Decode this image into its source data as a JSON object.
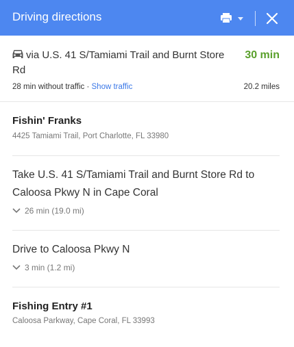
{
  "header": {
    "title": "Driving directions",
    "accent_color": "#4d87f0",
    "print_icon": "printer-icon",
    "close_icon": "close-icon"
  },
  "route": {
    "icon": "car-icon",
    "via": "via U.S. 41 S/Tamiami Trail and Burnt Store Rd",
    "duration": "30 min",
    "duration_color": "#5aa02c",
    "no_traffic": "28 min without traffic",
    "separator": "·",
    "show_traffic": "Show traffic",
    "distance": "20.2 miles"
  },
  "origin": {
    "name": "Fishin' Franks",
    "address": "4425 Tamiami Trail, Port Charlotte, FL 33980"
  },
  "steps": [
    {
      "text": "Take U.S. 41 S/Tamiami Trail and Burnt Store Rd to Caloosa Pkwy N in Cape Coral",
      "meta": "26 min (19.0 mi)"
    },
    {
      "text": "Drive to Caloosa Pkwy N",
      "meta": "3 min (1.2 mi)"
    }
  ],
  "destination": {
    "name": "Fishing Entry #1",
    "address": "Caloosa Parkway, Cape Coral, FL 33993"
  }
}
